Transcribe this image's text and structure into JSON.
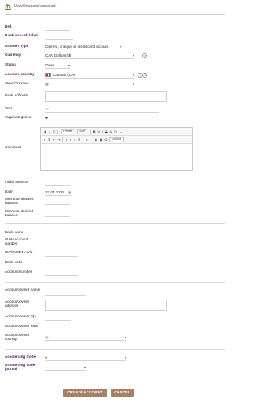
{
  "header": {
    "title": "New financial account"
  },
  "fields": {
    "ref": "Ref.",
    "label": "Bank or cash label",
    "account_type": "Account type",
    "account_type_value": "Current, cheque or credit card account",
    "currency": "Currency",
    "currency_value": "CAN Dollars ($)",
    "status": "Status",
    "status_value": "Open",
    "country": "Account country",
    "country_value": "Canada (CA)",
    "state": "State/Province",
    "address": "Bank address",
    "web": "Web",
    "tags": "Tags/categories",
    "comment": "Comment",
    "initial_balance": "Initial balance",
    "date": "Date",
    "date_value": "22.04.2026",
    "min_allowed": "Minimum allowed balance",
    "min_desired": "Minimum desired balance",
    "bank_name": "Bank name",
    "iban": "IBAN account number",
    "bic": "BIC/SWIFT code",
    "bank_code": "Bank code",
    "account_number": "Account number",
    "owner_name": "Account owner name",
    "owner_address": "Account owner address",
    "owner_zip": "Account owner zip",
    "owner_town": "Account owner town",
    "owner_country": "Account owner country",
    "accounting_code": "Accounting Code",
    "accounting_journal": "Accounting code journal"
  },
  "editor": {
    "format": "Format",
    "size": "Size",
    "source": "Source"
  },
  "buttons": {
    "create": "CREATE ACCOUNT",
    "cancel": "CANCEL"
  },
  "colors": {
    "required_label": "#4b1f55",
    "button": "#a58167",
    "title": "#6b3c7a"
  }
}
